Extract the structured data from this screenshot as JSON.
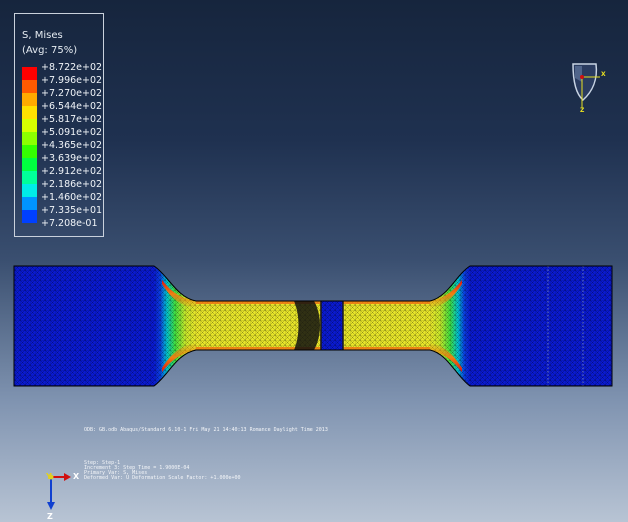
{
  "legend": {
    "title": "S, Mises",
    "subtitle": "(Avg: 75%)",
    "labels": [
      "+8.722e+02",
      "+7.996e+02",
      "+7.270e+02",
      "+6.544e+02",
      "+5.817e+02",
      "+5.091e+02",
      "+4.365e+02",
      "+3.639e+02",
      "+2.912e+02",
      "+2.186e+02",
      "+1.460e+02",
      "+7.335e+01",
      "+7.208e-01"
    ],
    "colors": [
      "#ff0000",
      "#ff5a00",
      "#ffaa00",
      "#ffe000",
      "#d6ff00",
      "#8cff00",
      "#34ff00",
      "#00ff40",
      "#00ff9a",
      "#00ece8",
      "#0094ff",
      "#0040ff",
      "#0000ff"
    ]
  },
  "model": {
    "colors": {
      "base": "#0a1ad0",
      "mesh": "#000000",
      "red": "#e01010",
      "orange": "#f08010",
      "yellow": "#e8e62a",
      "green": "#40e040"
    }
  },
  "info": {
    "odb_line": "ODB: GB.odb    Abaqus/Standard 6.10-1    Fri May 21 14:40:13 Romance Daylight Time 2013",
    "step_line": "Step: Step-1",
    "increment_line": "Increment      3: Step Time =    1.9000E-04",
    "primary_var_line": "Primary Var: S, Mises",
    "deformed_var_line": "Deformed Var: U   Deformation Scale Factor: +1.000e+00"
  },
  "triad": {
    "y_label": "Y",
    "x_label": "X",
    "z_label": "Z",
    "colors": {
      "y": "#e0d020",
      "x": "#d01010",
      "z": "#1040d0"
    }
  },
  "view_cube": {
    "x_label": "X",
    "z_label": "Z"
  }
}
